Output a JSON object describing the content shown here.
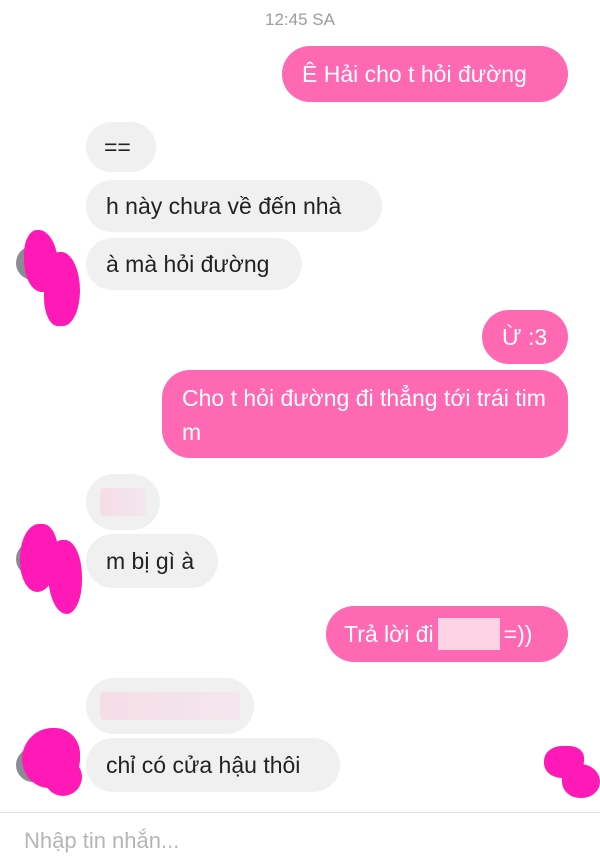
{
  "timestamp": "12:45 SA",
  "messages": {
    "m1": "Ê Hải cho t hỏi đường",
    "m2": "==",
    "m3": "h này chưa về đến nhà",
    "m4": "à mà hỏi đường",
    "m5": "Ừ :3",
    "m6": "Cho t hỏi đường đi thẳng tới trái tim m",
    "m8": "m bị gì à",
    "m9_before": "Trả lời đi",
    "m9_after": "=))",
    "m11": "chỉ có cửa hậu thôi"
  },
  "composer": {
    "placeholder": "Nhập tin nhắn..."
  },
  "colors": {
    "outgoing_bubble": "#ff69b4",
    "incoming_bubble": "#f0f0f0",
    "redaction": "#ff19b6"
  }
}
